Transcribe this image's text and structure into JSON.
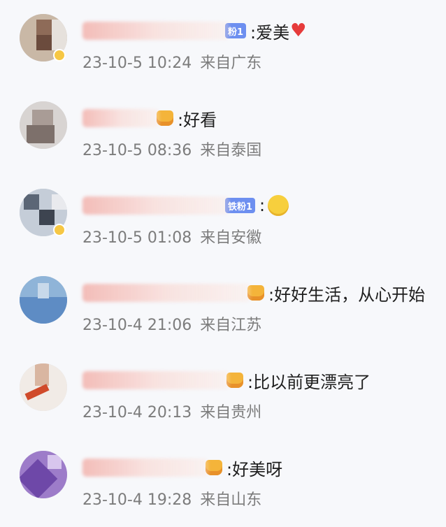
{
  "comments": [
    {
      "content": ":爱美",
      "time": "23-10-5 10:24",
      "location": "来自广东",
      "fan_badge": "粉1"
    },
    {
      "content": ":好看",
      "time": "23-10-5 08:36",
      "location": "来自泰国"
    },
    {
      "content": ":",
      "time": "23-10-5 01:08",
      "location": "来自安徽",
      "fan_badge": "铁粉1"
    },
    {
      "content": ":好好生活，从心开始",
      "time": "23-10-4 21:06",
      "location": "来自江苏"
    },
    {
      "content": ":比以前更漂亮了",
      "time": "23-10-4 20:13",
      "location": "来自贵州"
    },
    {
      "content": ":好美呀",
      "time": "23-10-4 19:28",
      "location": "来自山东"
    }
  ],
  "colors": {
    "accent": "#6d8ff0",
    "meta_text": "#7c7c7c",
    "heart": "#e63b3b"
  }
}
